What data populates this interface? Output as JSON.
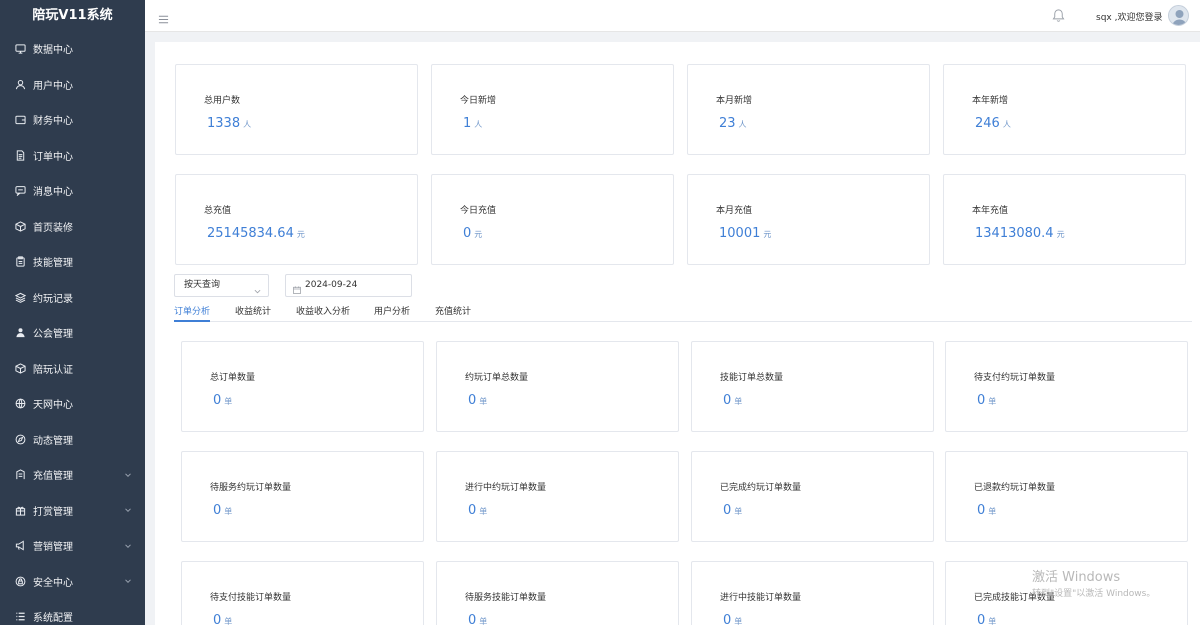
{
  "app": {
    "title": "陪玩V11系统"
  },
  "sidebar": {
    "items": [
      {
        "label": "数据中心",
        "icon": "monitor-icon",
        "expandable": false
      },
      {
        "label": "用户中心",
        "icon": "user-icon",
        "expandable": false
      },
      {
        "label": "财务中心",
        "icon": "wallet-icon",
        "expandable": false
      },
      {
        "label": "订单中心",
        "icon": "document-icon",
        "expandable": false
      },
      {
        "label": "消息中心",
        "icon": "chat-icon",
        "expandable": false
      },
      {
        "label": "首页装修",
        "icon": "box-icon",
        "expandable": false
      },
      {
        "label": "技能管理",
        "icon": "clipboard-icon",
        "expandable": false
      },
      {
        "label": "约玩记录",
        "icon": "layers-icon",
        "expandable": false
      },
      {
        "label": "公会管理",
        "icon": "guild-icon",
        "expandable": false
      },
      {
        "label": "陪玩认证",
        "icon": "cube-icon",
        "expandable": false
      },
      {
        "label": "天网中心",
        "icon": "globe-icon",
        "expandable": false
      },
      {
        "label": "动态管理",
        "icon": "compass-icon",
        "expandable": false
      },
      {
        "label": "充值管理",
        "icon": "recharge-icon",
        "expandable": true
      },
      {
        "label": "打赏管理",
        "icon": "gift-icon",
        "expandable": true
      },
      {
        "label": "营销管理",
        "icon": "campaign-icon",
        "expandable": true
      },
      {
        "label": "安全中心",
        "icon": "lock-icon",
        "expandable": true
      },
      {
        "label": "系统配置",
        "icon": "list-icon",
        "expandable": false
      }
    ]
  },
  "header": {
    "welcome": "sqx ,欢迎您登录"
  },
  "user_stats": [
    {
      "label": "总用户数",
      "value": "1338",
      "unit": "人"
    },
    {
      "label": "今日新增",
      "value": "1",
      "unit": "人"
    },
    {
      "label": "本月新增",
      "value": "23",
      "unit": "人"
    },
    {
      "label": "本年新增",
      "value": "246",
      "unit": "人"
    }
  ],
  "recharge_stats": [
    {
      "label": "总充值",
      "value": "25145834.64",
      "unit": "元"
    },
    {
      "label": "今日充值",
      "value": "0",
      "unit": "元"
    },
    {
      "label": "本月充值",
      "value": "10001",
      "unit": "元"
    },
    {
      "label": "本年充值",
      "value": "13413080.4",
      "unit": "元"
    }
  ],
  "filters": {
    "query_mode": "按天查询",
    "date": "2024-09-24"
  },
  "tabs": [
    {
      "label": "订单分析",
      "active": true
    },
    {
      "label": "收益统计",
      "active": false
    },
    {
      "label": "收益收入分析",
      "active": false
    },
    {
      "label": "用户分析",
      "active": false
    },
    {
      "label": "充值统计",
      "active": false
    }
  ],
  "order_stats": [
    {
      "label": "总订单数量",
      "value": "0",
      "unit": "单"
    },
    {
      "label": "约玩订单总数量",
      "value": "0",
      "unit": "单"
    },
    {
      "label": "技能订单总数量",
      "value": "0",
      "unit": "单"
    },
    {
      "label": "待支付约玩订单数量",
      "value": "0",
      "unit": "单"
    },
    {
      "label": "待服务约玩订单数量",
      "value": "0",
      "unit": "单"
    },
    {
      "label": "进行中约玩订单数量",
      "value": "0",
      "unit": "单"
    },
    {
      "label": "已完成约玩订单数量",
      "value": "0",
      "unit": "单"
    },
    {
      "label": "已退款约玩订单数量",
      "value": "0",
      "unit": "单"
    },
    {
      "label": "待支付技能订单数量",
      "value": "0",
      "unit": "单"
    },
    {
      "label": "待服务技能订单数量",
      "value": "0",
      "unit": "单"
    },
    {
      "label": "进行中技能订单数量",
      "value": "0",
      "unit": "单"
    },
    {
      "label": "已完成技能订单数量",
      "value": "0",
      "unit": "单"
    }
  ],
  "watermark": {
    "line1": "激活 Windows",
    "line2": "转到\"设置\"以激活 Windows。"
  },
  "colors": {
    "sidebar_bg": "#2f3c4e",
    "accent": "#3f7fd6"
  }
}
